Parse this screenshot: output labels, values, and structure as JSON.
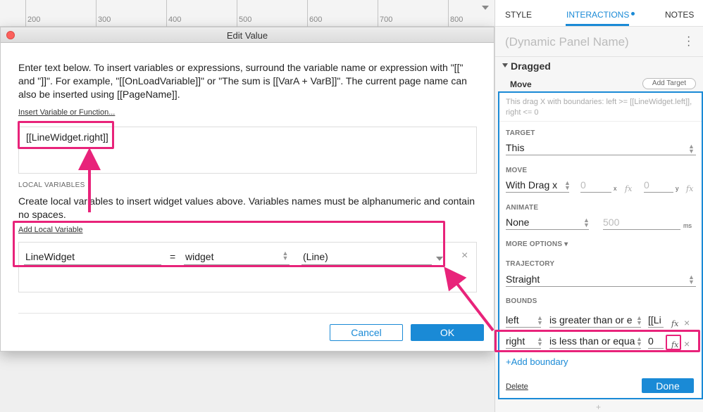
{
  "ruler": {
    "labels": [
      "200",
      "300",
      "400",
      "500",
      "600",
      "700",
      "800"
    ]
  },
  "dialog": {
    "title": "Edit Value",
    "intro": "Enter text below. To insert variables or expressions, surround the variable name or expression with \"[[\" and \"]]\". For example, \"[[OnLoadVariable]]\" or \"The sum is [[VarA + VarB]]\". The current page name can also be inserted using [[PageName]].",
    "insert_link": "Insert Variable or Function...",
    "expression": "[[LineWidget.right]]",
    "local_vars_heading": "LOCAL VARIABLES",
    "local_vars_desc": "Create local variables to insert widget values above. Variables names must be alphanumeric and contain no spaces.",
    "add_local_var": "Add Local Variable",
    "local_var": {
      "name": "LineWidget",
      "equals": "=",
      "type": "widget",
      "target": "(Line)",
      "remove": "×"
    },
    "cancel_label": "Cancel",
    "ok_label": "OK"
  },
  "panel": {
    "tabs": {
      "style": "STYLE",
      "interactions": "INTERACTIONS",
      "notes": "NOTES"
    },
    "name_placeholder": "(Dynamic Panel Name)",
    "event": "Dragged",
    "action": "Move",
    "add_target": "Add Target",
    "description": "This drag X  with boundaries: left >= [[LineWidget.left]], right <= 0",
    "target_label": "TARGET",
    "target_value": "This",
    "move_label": "MOVE",
    "move_value": "With Drag x",
    "move_x": "0",
    "move_x_unit": "x",
    "move_y": "0",
    "move_y_unit": "y",
    "animate_label": "ANIMATE",
    "animate_value": "None",
    "animate_ms": "500",
    "animate_unit": "ms",
    "more_options": "MORE OPTIONS ▾",
    "trajectory_label": "TRAJECTORY",
    "trajectory_value": "Straight",
    "bounds_label": "BOUNDS",
    "bounds": [
      {
        "side": "left",
        "op": "is greater than or e",
        "value": "[[Li"
      },
      {
        "side": "right",
        "op": "is less than or equa",
        "value": "0"
      }
    ],
    "fx_label": "fx",
    "add_boundary": "+Add boundary",
    "delete_label": "Delete",
    "done_label": "Done",
    "plus": "+"
  },
  "colors": {
    "accent": "#1a8ad6",
    "highlight": "#e8237a"
  }
}
